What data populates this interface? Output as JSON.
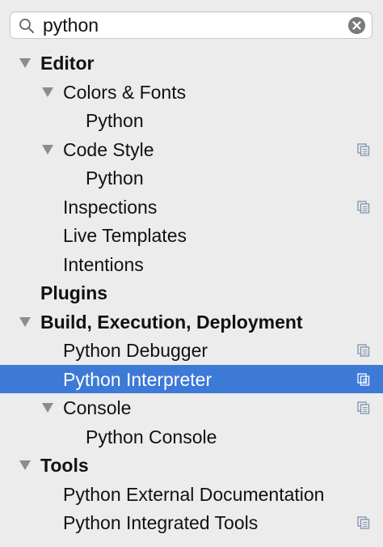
{
  "search": {
    "value": "python",
    "placeholder": ""
  },
  "icons": {
    "search": "search-icon",
    "clear": "clear-icon",
    "expand": "triangle-down-icon",
    "scope": "project-scope-icon"
  },
  "colors": {
    "selection": "#3d79d6",
    "background": "#ececec",
    "arrow": "#8c8c8c",
    "scope_icon": "#7e93b0"
  },
  "tree": {
    "items": [
      {
        "label": "Editor",
        "level": 0,
        "bold": true,
        "expanded": true,
        "scope_icon": false,
        "selected": false
      },
      {
        "label": "Colors & Fonts",
        "level": 1,
        "bold": false,
        "expanded": true,
        "scope_icon": false,
        "selected": false
      },
      {
        "label": "Python",
        "level": 2,
        "bold": false,
        "expanded": false,
        "scope_icon": false,
        "selected": false
      },
      {
        "label": "Code Style",
        "level": 1,
        "bold": false,
        "expanded": true,
        "scope_icon": true,
        "selected": false
      },
      {
        "label": "Python",
        "level": 2,
        "bold": false,
        "expanded": false,
        "scope_icon": false,
        "selected": false
      },
      {
        "label": "Inspections",
        "level": 1,
        "bold": false,
        "expanded": false,
        "scope_icon": true,
        "selected": false
      },
      {
        "label": "Live Templates",
        "level": 1,
        "bold": false,
        "expanded": false,
        "scope_icon": false,
        "selected": false
      },
      {
        "label": "Intentions",
        "level": 1,
        "bold": false,
        "expanded": false,
        "scope_icon": false,
        "selected": false
      },
      {
        "label": "Plugins",
        "level": 0,
        "bold": true,
        "expanded": false,
        "scope_icon": false,
        "selected": false
      },
      {
        "label": "Build, Execution, Deployment",
        "level": 0,
        "bold": true,
        "expanded": true,
        "scope_icon": false,
        "selected": false
      },
      {
        "label": "Python Debugger",
        "level": 1,
        "bold": false,
        "expanded": false,
        "scope_icon": true,
        "selected": false
      },
      {
        "label": "Python Interpreter",
        "level": 1,
        "bold": false,
        "expanded": false,
        "scope_icon": true,
        "selected": true
      },
      {
        "label": "Console",
        "level": 1,
        "bold": false,
        "expanded": true,
        "scope_icon": true,
        "selected": false
      },
      {
        "label": "Python Console",
        "level": 2,
        "bold": false,
        "expanded": false,
        "scope_icon": false,
        "selected": false
      },
      {
        "label": "Tools",
        "level": 0,
        "bold": true,
        "expanded": true,
        "scope_icon": false,
        "selected": false
      },
      {
        "label": "Python External Documentation",
        "level": 1,
        "bold": false,
        "expanded": false,
        "scope_icon": false,
        "selected": false
      },
      {
        "label": "Python Integrated Tools",
        "level": 1,
        "bold": false,
        "expanded": false,
        "scope_icon": true,
        "selected": false
      }
    ]
  }
}
